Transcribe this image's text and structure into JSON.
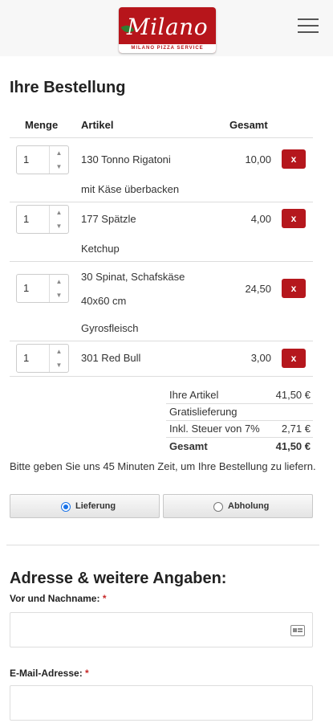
{
  "header": {
    "logo_name": "Milano",
    "logo_tagline": "MILANO PIZZA SERVICE"
  },
  "order": {
    "title": "Ihre Bestellung",
    "columns": {
      "qty": "Menge",
      "article": "Artikel",
      "total": "Gesamt"
    },
    "items": [
      {
        "qty": "1",
        "name": "130 Tonno Rigatoni",
        "options": [
          "mit Käse überbacken"
        ],
        "price": "10,00",
        "remove": "x"
      },
      {
        "qty": "1",
        "name": "177 Spätzle",
        "options": [
          "Ketchup"
        ],
        "price": "4,00",
        "remove": "x"
      },
      {
        "qty": "1",
        "name": "30 Spinat, Schafskäse",
        "options": [
          "40x60 cm",
          "Gyrosfleisch"
        ],
        "price": "24,50",
        "remove": "x"
      },
      {
        "qty": "1",
        "name": "301 Red Bull",
        "options": [],
        "price": "3,00",
        "remove": "x"
      }
    ],
    "summary": {
      "items_label": "Ihre Artikel",
      "items_value": "41,50 €",
      "delivery_label": "Gratislieferung",
      "tax_label": "Inkl. Steuer von 7%",
      "tax_value": "2,71 €",
      "total_label": "Gesamt",
      "total_value": "41,50 €"
    },
    "note": "Bitte geben Sie uns 45 Minuten Zeit, um Ihre Bestellung zu liefern.",
    "modes": [
      {
        "label": "Lieferung",
        "selected": true
      },
      {
        "label": "Abholung",
        "selected": false
      }
    ]
  },
  "address": {
    "title": "Adresse & weitere Angaben:",
    "name_label": "Vor und Nachname:",
    "email_label": "E-Mail-Adresse:",
    "required_mark": "*"
  },
  "colors": {
    "brand_red": "#b7151b",
    "accent_blue": "#1a73e8"
  },
  "icons": {
    "menu": "hamburger-icon",
    "contact_card": "contact-card-icon"
  }
}
